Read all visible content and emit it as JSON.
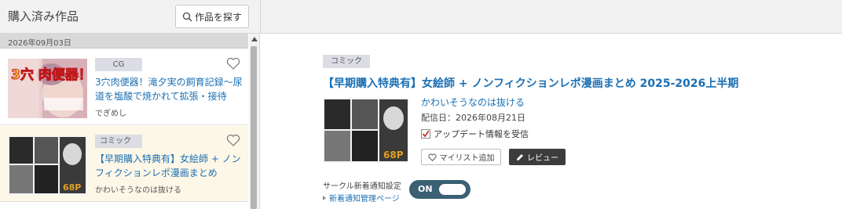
{
  "header": {
    "title": "購入済み作品",
    "search_label": "作品を探す",
    "search_icon": "search-icon"
  },
  "list": {
    "date": "2026年09月03日",
    "items": [
      {
        "category": "CG",
        "title": "3穴肉便器！滝夕実の飼育記録～尿道を塩酸で焼かれて拡張・接待",
        "circle": "でぎめし",
        "thumb_text": "3穴 肉便器！",
        "favorite_icon": "heart-outline-icon"
      },
      {
        "category": "コミック",
        "title": "【早期購入特典有】女絵師 + ノンフィクションレポ漫画まとめ",
        "circle": "かわいそうなのは抜ける",
        "thumb_text": "68P",
        "favorite_icon": "heart-outline-icon"
      }
    ]
  },
  "detail": {
    "category": "コミック",
    "title": "【早期購入特典有】女絵師 + ノンフィクションレポ漫画まとめ 2025-2026上半期",
    "circle": "かわいそうなのは抜ける",
    "release_date": "配信日：2026年08月21日",
    "update_checkbox_label": "アップデート情報を受信",
    "update_checked": true,
    "wishlist_label": "マイリスト追加",
    "review_label": "レビュー",
    "notice_label": "サークル新着通知設定",
    "toggle_label": "ON",
    "manage_link": "新着通知管理ページ",
    "thumb_text": "68P"
  },
  "colors": {
    "link": "#1a6fb3",
    "toggle_bg": "#3b5f73",
    "check": "#c0392b",
    "selected_row": "#fdf7e8"
  }
}
